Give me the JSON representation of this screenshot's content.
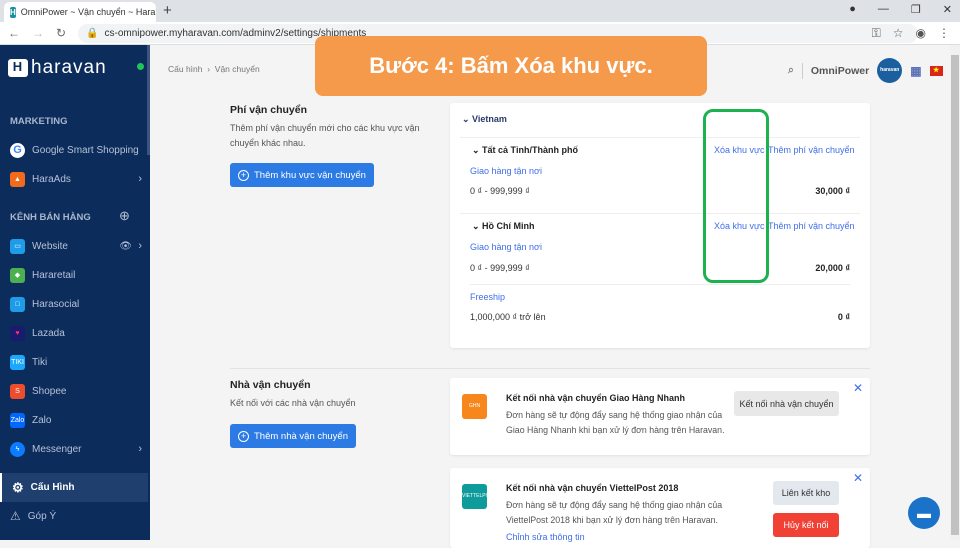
{
  "browser": {
    "tab_title": "OmniPower ~ Vận chuyển ~ Hara",
    "url": "cs-omnipower.myharavan.com/adminv2/settings/shipments"
  },
  "sidebar": {
    "logo": "haravan",
    "sections": {
      "marketing": "MARKETING",
      "channels": "KÊNH BÁN HÀNG"
    },
    "items": [
      {
        "label": "Google Smart Shopping",
        "color": "#ffffff"
      },
      {
        "label": "HaraAds",
        "color": "#f26b1d"
      },
      {
        "label": "Website",
        "color": "#1e9be9"
      },
      {
        "label": "Hararetail",
        "color": "#4caf50"
      },
      {
        "label": "Harasocial",
        "color": "#1e9be9"
      },
      {
        "label": "Lazada",
        "color": "#1a1a6e"
      },
      {
        "label": "Tiki",
        "color": "#1ba8ff"
      },
      {
        "label": "Shopee",
        "color": "#ee4d2d"
      },
      {
        "label": "Zalo",
        "color": "#0068ff"
      },
      {
        "label": "Messenger",
        "color": "#0a7cff"
      }
    ],
    "settings": "Cấu Hình",
    "feedback": "Góp Ý"
  },
  "breadcrumb": {
    "root": "Cấu hình",
    "current": "Vận chuyển"
  },
  "banner": "Bước 4: Bấm Xóa khu vực.",
  "header": {
    "store": "OmniPower",
    "avatar": "haravan"
  },
  "fees": {
    "title": "Phí vận chuyển",
    "desc": "Thêm phí vận chuyển mới cho các khu vực vận chuyển khác nhau.",
    "add_button": "Thêm khu vực vận chuyển",
    "country": "Vietnam",
    "zones": [
      {
        "name": "Tất cả Tỉnh/Thành phố",
        "delete": "Xóa khu vực",
        "add_fee": "Thêm phí vận chuyển",
        "rates": [
          {
            "name": "Giao hàng tận nơi",
            "range": "0 ₫ - 999,999 ₫",
            "price": "30,000 ₫"
          }
        ]
      },
      {
        "name": "Hồ Chí Minh",
        "delete": "Xóa khu vực",
        "add_fee": "Thêm phí vận chuyển",
        "rates": [
          {
            "name": "Giao hàng tận nơi",
            "range": "0 ₫ - 999,999 ₫",
            "price": "20,000 ₫"
          },
          {
            "name": "Freeship",
            "range": "1,000,000 ₫ trở lên",
            "price": "0 ₫"
          }
        ]
      }
    ]
  },
  "carriers": {
    "title": "Nhà vận chuyển",
    "desc": "Kết nối với các nhà vận chuyển",
    "add_button": "Thêm nhà vận chuyển",
    "list": [
      {
        "logo": "GHN",
        "title": "Kết nối nhà vận chuyển Giao Hàng Nhanh",
        "desc": "Đơn hàng sẽ tự động đẩy sang hệ thống giao nhận của Giao Hàng Nhanh khi bạn xử lý đơn hàng trên Haravan.",
        "button": "Kết nối nhà vận chuyển"
      },
      {
        "logo": "VIETTELPOST",
        "title": "Kết nối nhà vận chuyển ViettelPost 2018",
        "desc": "Đơn hàng sẽ tự động đẩy sang hệ thống giao nhận của ViettelPost 2018 khi bạn xử lý đơn hàng trên Haravan.",
        "button": "Liên kết kho",
        "button2": "Hủy kết nối",
        "link": "Chỉnh sửa thông tin"
      }
    ]
  }
}
